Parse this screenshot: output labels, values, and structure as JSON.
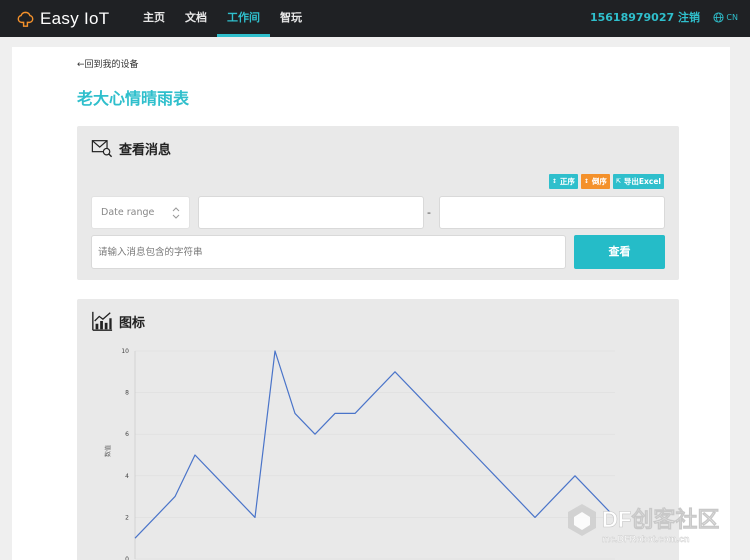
{
  "brand": {
    "name": "Easy IoT",
    "color": "#2fbfcc"
  },
  "nav": {
    "items": [
      {
        "label": "主页",
        "active": false
      },
      {
        "label": "文档",
        "active": false
      },
      {
        "label": "工作间",
        "active": true
      },
      {
        "label": "智玩",
        "active": false
      }
    ]
  },
  "user": {
    "phone": "15618979027",
    "logout": "注销"
  },
  "lang": {
    "label": "CN",
    "icon": "globe-icon"
  },
  "back": {
    "label": "←回到我的设备"
  },
  "device": {
    "title": "老大心情晴雨表"
  },
  "messages": {
    "title": "查看消息",
    "icon": "envelope-search-icon",
    "buttons": {
      "asc": "正序",
      "desc": "倒序",
      "excel": "导出Excel"
    },
    "colors": {
      "asc": "#2fbfcc",
      "desc": "#f4912b",
      "excel": "#2fbfcc"
    },
    "date_range_label": "Date range",
    "range_separator": "-",
    "from_value": "",
    "to_value": "",
    "search_placeholder": "请输入消息包含的字符串",
    "view_button": "查看"
  },
  "chart_panel": {
    "title": "图标",
    "icon": "chart-icon"
  },
  "chart_data": {
    "type": "line",
    "ylabel": "数值",
    "y_ticks": [
      0,
      2,
      4,
      6,
      8,
      10
    ],
    "ylim": [
      0,
      10
    ],
    "x": [
      0,
      1,
      2,
      3,
      4,
      5,
      6,
      7,
      8,
      9,
      10,
      11,
      12,
      13,
      14,
      15,
      16,
      17,
      18,
      19,
      20,
      21,
      22,
      23,
      24
    ],
    "series": [
      {
        "color": "#4a74c9",
        "values": [
          1,
          2,
          3,
          5,
          4,
          3,
          2,
          10,
          7,
          6,
          7,
          7,
          8,
          9,
          8,
          7,
          6,
          5,
          4,
          3,
          2,
          3,
          4,
          3,
          2
        ]
      }
    ],
    "xlim": [
      0,
      24
    ],
    "grid": true
  },
  "watermark": {
    "text": "DF创客社区",
    "url": "mc.DFRobot.com.cn"
  }
}
